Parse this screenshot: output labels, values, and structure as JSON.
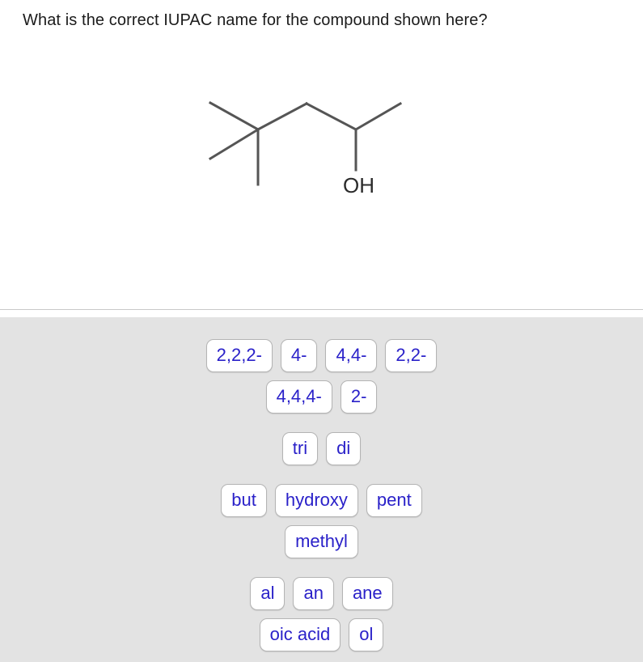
{
  "question": {
    "prompt": "What is the correct IUPAC name for the compound shown here?"
  },
  "molecule": {
    "label_oh": "OH",
    "bond_color": "#555555",
    "label_color": "#2b2b2b",
    "depicted_compound": "4,4-dimethylpentan-2-ol"
  },
  "answer_bank": {
    "rows": [
      {
        "tiles": [
          {
            "label": "2,2,2-"
          },
          {
            "label": "4-"
          },
          {
            "label": "4,4-"
          },
          {
            "label": "2,2-"
          }
        ]
      },
      {
        "tiles": [
          {
            "label": "4,4,4-"
          },
          {
            "label": "2-"
          }
        ]
      },
      {
        "tiles": [
          {
            "label": "tri"
          },
          {
            "label": "di"
          }
        ]
      },
      {
        "tiles": [
          {
            "label": "but"
          },
          {
            "label": "hydroxy"
          },
          {
            "label": "pent"
          }
        ]
      },
      {
        "tiles": [
          {
            "label": "methyl"
          }
        ]
      },
      {
        "tiles": [
          {
            "label": "al"
          },
          {
            "label": "an"
          },
          {
            "label": "ane"
          }
        ]
      },
      {
        "tiles": [
          {
            "label": "oic acid"
          },
          {
            "label": "ol"
          }
        ]
      }
    ]
  },
  "colors": {
    "page_background": "#ffffff",
    "answer_panel_background": "#e3e3e3",
    "tile_background": "#ffffff",
    "tile_border": "#b4b4b4",
    "tile_text": "#2a21c9",
    "divider": "#c9c9c9",
    "question_text": "#1b1b1b"
  }
}
